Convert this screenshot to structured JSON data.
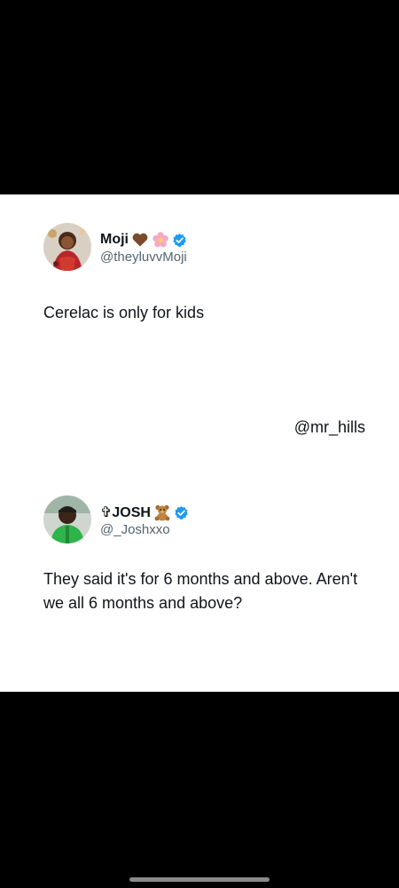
{
  "tweets": [
    {
      "display_name": "Moji",
      "emoji": [
        "brown-heart-icon",
        "pink-flower-icon"
      ],
      "verified": true,
      "handle": "@theyluvvMoji",
      "text": "Cerelac is only for kids"
    },
    {
      "display_name": "✞JOSH",
      "emoji": [
        "teddy-bear-icon"
      ],
      "verified": true,
      "handle": "@_Joshxxo",
      "text": "They said it's for 6 months and above. Aren't we all 6 months and above?"
    }
  ],
  "watermark": "@mr_hills",
  "colors": {
    "background": "#000000",
    "card": "#ffffff",
    "text": "#0f1419",
    "secondary_text": "#536471",
    "verified_badge": "#1d9bf0"
  }
}
